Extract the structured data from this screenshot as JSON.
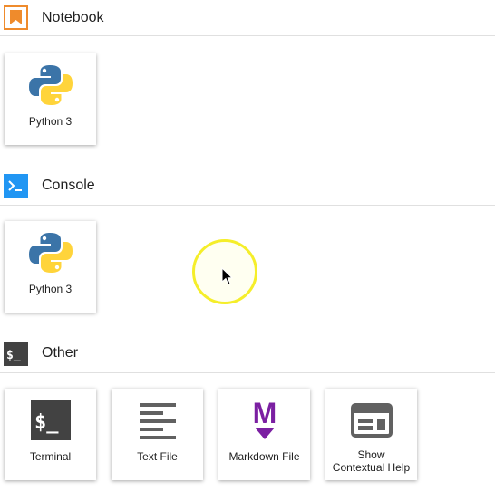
{
  "colors": {
    "notebook_accent": "#ef8b2c",
    "console_accent": "#2196f3",
    "other_accent": "#424242",
    "markdown_accent": "#7b1fa2",
    "python_blue": "#3b74a8",
    "python_yellow": "#ffd43b",
    "cursor_ring": "#f5ee2a"
  },
  "sections": {
    "notebook": {
      "title": "Notebook",
      "icon": "bookmark-icon",
      "cards": [
        {
          "label": "Python 3",
          "icon": "python-logo-icon"
        }
      ]
    },
    "console": {
      "title": "Console",
      "icon": "console-prompt-icon",
      "cards": [
        {
          "label": "Python 3",
          "icon": "python-logo-icon"
        }
      ]
    },
    "other": {
      "title": "Other",
      "icon": "terminal-dollar-icon",
      "cards": [
        {
          "label": "Terminal",
          "icon": "terminal-icon",
          "glyph": "$_"
        },
        {
          "label": "Text File",
          "icon": "text-lines-icon"
        },
        {
          "label": "Markdown File",
          "icon": "markdown-m-icon",
          "glyph": "M"
        },
        {
          "label_line1": "Show",
          "label_line2": "Contextual Help",
          "icon": "contextual-help-layout-icon"
        }
      ]
    }
  },
  "icon_glyphs": {
    "console": ">_",
    "other": "$_"
  }
}
